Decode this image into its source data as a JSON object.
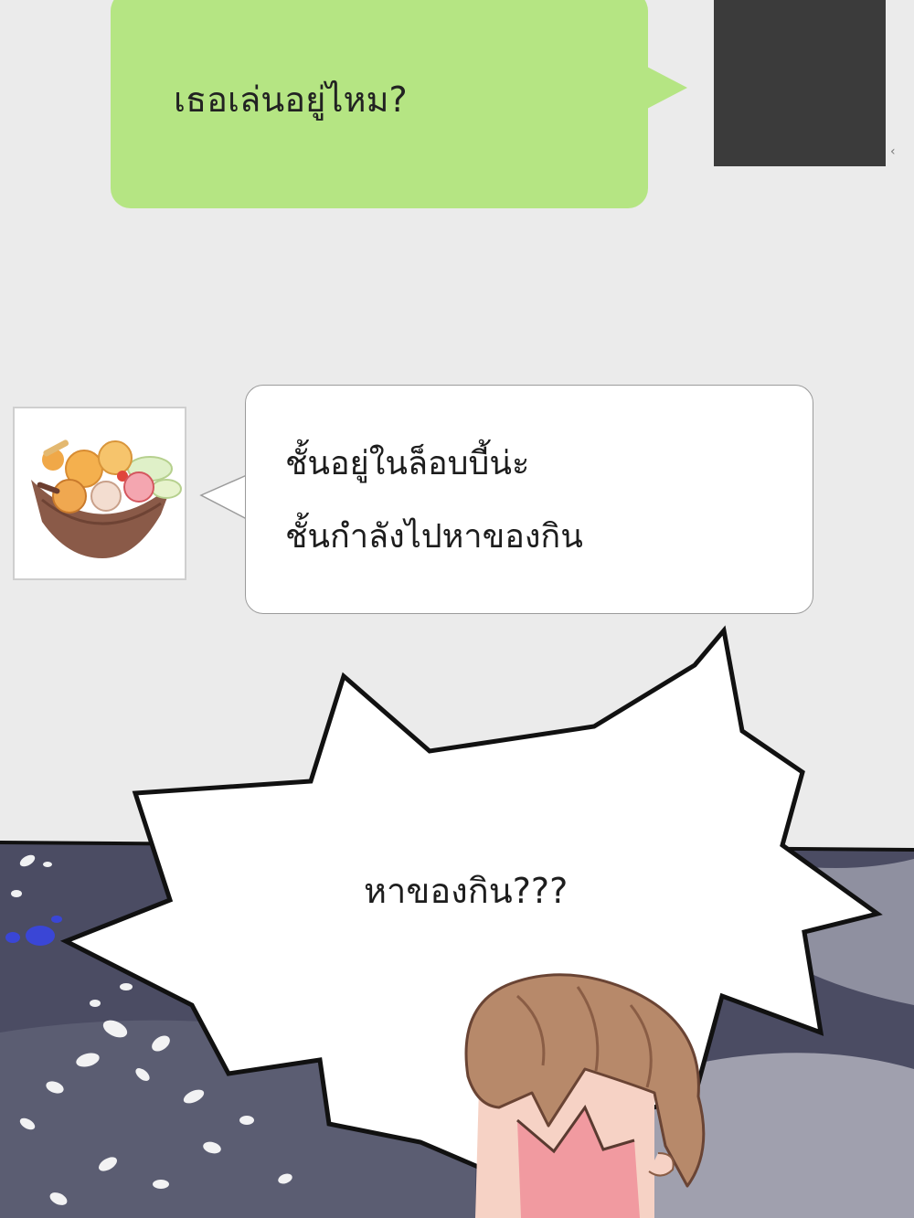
{
  "chat": {
    "sent_message": "เธอเล่นอยู่ไหม?",
    "edge_glyph": "‹",
    "received_lines": [
      "ชั้นอยู่ในล็อบบี้น่ะ",
      "ชั้นกำลังไปหาของกิน"
    ]
  },
  "shout": {
    "text": "หาของกิน???"
  },
  "icons": {
    "friend_avatar": "food-basket-icon",
    "self_avatar": "dark-placeholder"
  },
  "colors": {
    "chat_background": "#ebebeb",
    "sent_bubble": "#b5e583",
    "received_bubble": "#ffffff",
    "self_avatar": "#3b3b3b",
    "night_sky": "#4b4c63",
    "petal": "#ffffff",
    "blue_petal": "#3a46d6",
    "hair": "#b7896a",
    "skin": "#f6d2c5"
  }
}
